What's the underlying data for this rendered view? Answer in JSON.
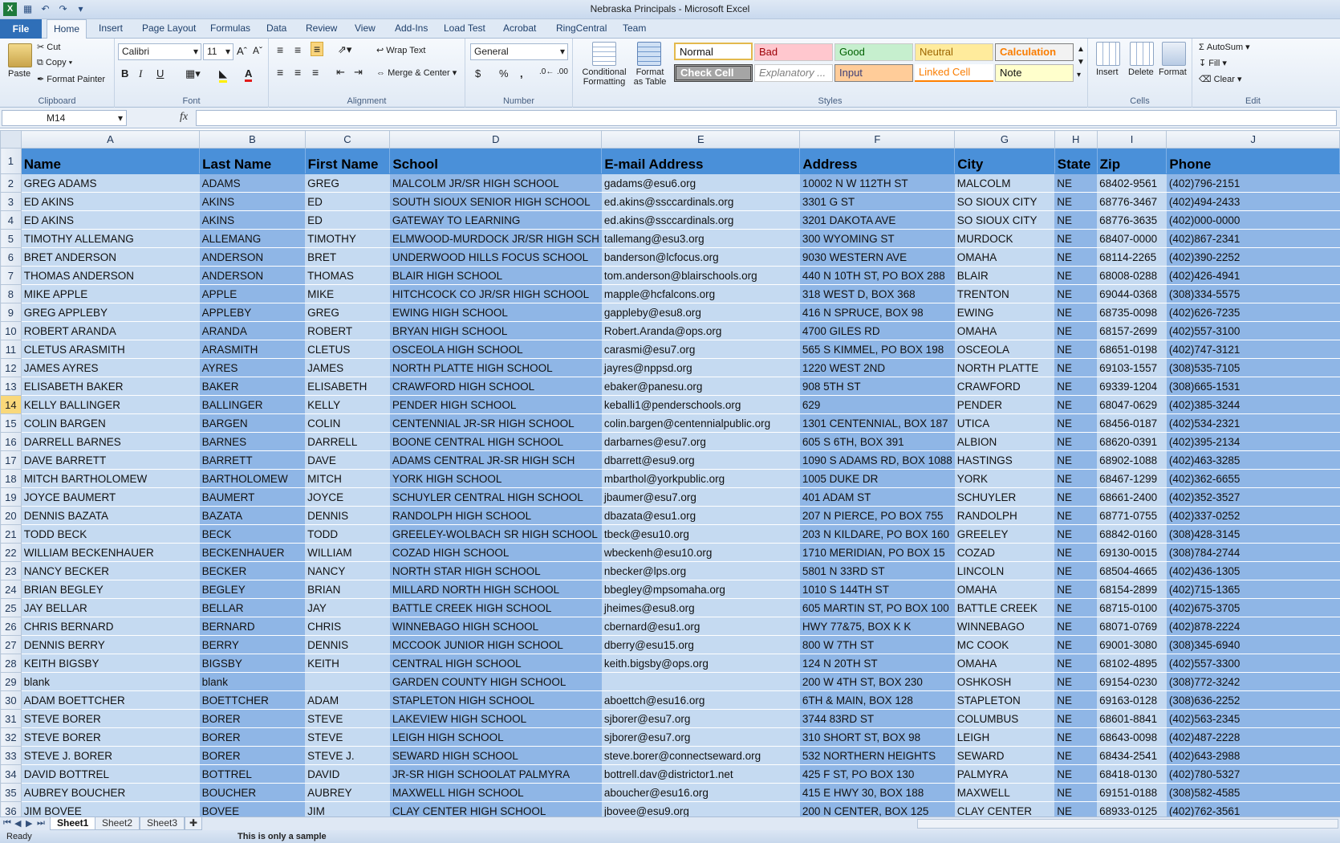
{
  "app": {
    "window_title": "Nebraska Principals  -  Microsoft Excel"
  },
  "menu": {
    "file": "File",
    "tabs": [
      "Home",
      "Insert",
      "Page Layout",
      "Formulas",
      "Data",
      "Review",
      "View",
      "Add-Ins",
      "Load Test",
      "Acrobat",
      "RingCentral",
      "Team"
    ]
  },
  "ribbon": {
    "clipboard": {
      "paste": "Paste",
      "cut": "Cut",
      "copy": "Copy",
      "format_painter": "Format Painter",
      "label": "Clipboard"
    },
    "font": {
      "name": "Calibri",
      "size": "11",
      "bold": "B",
      "italic": "I",
      "underline": "U",
      "label": "Font"
    },
    "alignment": {
      "wrap_text": "Wrap Text",
      "merge_center": "Merge & Center",
      "label": "Alignment"
    },
    "number": {
      "format": "General",
      "currency": "$",
      "percent": "%",
      "comma": ",",
      "label": "Number"
    },
    "styles": {
      "conditional_formatting": "Conditional Formatting",
      "format_as_table": "Format as Table",
      "cells": [
        "Normal",
        "Bad",
        "Good",
        "Neutral",
        "Calculation",
        "Check Cell",
        "Explanatory ...",
        "Input",
        "Linked Cell",
        "Note"
      ],
      "label": "Styles"
    },
    "cells": {
      "insert": "Insert",
      "delete": "Delete",
      "format": "Format",
      "label": "Cells"
    },
    "editing": {
      "autosum": "AutoSum",
      "fill": "Fill",
      "clear": "Clear",
      "label": "Edit"
    }
  },
  "formula_bar": {
    "name_box": "M14",
    "fx": "fx",
    "content": ""
  },
  "sheet": {
    "columns": [
      "A",
      "B",
      "C",
      "D",
      "E",
      "F",
      "G",
      "H",
      "I",
      "J"
    ],
    "headers": [
      "Name",
      "Last Name",
      "First Name",
      "School",
      "E-mail Address",
      "Address",
      "City",
      "State",
      "Zip",
      "Phone"
    ],
    "rows": [
      [
        "GREG ADAMS",
        "ADAMS",
        "GREG",
        "MALCOLM JR/SR HIGH SCHOOL",
        "gadams@esu6.org",
        "10002 N W 112TH ST",
        "MALCOLM",
        "NE",
        "68402-9561",
        "(402)796-2151"
      ],
      [
        "ED AKINS",
        "AKINS",
        "ED",
        "SOUTH SIOUX SENIOR HIGH SCHOOL",
        "ed.akins@ssccardinals.org",
        "3301 G ST",
        "SO SIOUX CITY",
        "NE",
        "68776-3467",
        "(402)494-2433"
      ],
      [
        "ED AKINS",
        "AKINS",
        "ED",
        "GATEWAY TO LEARNING",
        "ed.akins@ssccardinals.org",
        "3201 DAKOTA AVE",
        "SO SIOUX CITY",
        "NE",
        "68776-3635",
        "(402)000-0000"
      ],
      [
        "TIMOTHY ALLEMANG",
        "ALLEMANG",
        "TIMOTHY",
        "ELMWOOD-MURDOCK JR/SR HIGH SCH",
        "tallemang@esu3.org",
        "300 WYOMING ST",
        "MURDOCK",
        "NE",
        "68407-0000",
        "(402)867-2341"
      ],
      [
        "BRET ANDERSON",
        "ANDERSON",
        "BRET",
        "UNDERWOOD HILLS FOCUS SCHOOL",
        "banderson@lcfocus.org",
        "9030 WESTERN AVE",
        "OMAHA",
        "NE",
        "68114-2265",
        "(402)390-2252"
      ],
      [
        "THOMAS ANDERSON",
        "ANDERSON",
        "THOMAS",
        "BLAIR HIGH SCHOOL",
        "tom.anderson@blairschools.org",
        "440 N 10TH ST, PO BOX 288",
        "BLAIR",
        "NE",
        "68008-0288",
        "(402)426-4941"
      ],
      [
        "MIKE APPLE",
        "APPLE",
        "MIKE",
        "HITCHCOCK CO JR/SR HIGH SCHOOL",
        "mapple@hcfalcons.org",
        "318 WEST D, BOX 368",
        "TRENTON",
        "NE",
        "69044-0368",
        "(308)334-5575"
      ],
      [
        "GREG APPLEBY",
        "APPLEBY",
        "GREG",
        "EWING HIGH SCHOOL",
        "gappleby@esu8.org",
        "416 N SPRUCE, BOX 98",
        "EWING",
        "NE",
        "68735-0098",
        "(402)626-7235"
      ],
      [
        "ROBERT ARANDA",
        "ARANDA",
        "ROBERT",
        "BRYAN HIGH SCHOOL",
        "Robert.Aranda@ops.org",
        "4700 GILES RD",
        "OMAHA",
        "NE",
        "68157-2699",
        "(402)557-3100"
      ],
      [
        "CLETUS ARASMITH",
        "ARASMITH",
        "CLETUS",
        "OSCEOLA HIGH SCHOOL",
        "carasmi@esu7.org",
        "565 S KIMMEL, PO BOX 198",
        "OSCEOLA",
        "NE",
        "68651-0198",
        "(402)747-3121"
      ],
      [
        "JAMES AYRES",
        "AYRES",
        "JAMES",
        "NORTH PLATTE HIGH SCHOOL",
        "jayres@nppsd.org",
        "1220 WEST 2ND",
        "NORTH PLATTE",
        "NE",
        "69103-1557",
        "(308)535-7105"
      ],
      [
        "ELISABETH BAKER",
        "BAKER",
        "ELISABETH",
        "CRAWFORD HIGH SCHOOL",
        "ebaker@panesu.org",
        "908 5TH ST",
        "CRAWFORD",
        "NE",
        "69339-1204",
        "(308)665-1531"
      ],
      [
        "KELLY BALLINGER",
        "BALLINGER",
        "KELLY",
        "PENDER HIGH SCHOOL",
        "keballi1@penderschools.org",
        "629",
        "PENDER",
        "NE",
        "68047-0629",
        "(402)385-3244"
      ],
      [
        "COLIN BARGEN",
        "BARGEN",
        "COLIN",
        "CENTENNIAL JR-SR HIGH SCHOOL",
        "colin.bargen@centennialpublic.org",
        "1301 CENTENNIAL, BOX 187",
        "UTICA",
        "NE",
        "68456-0187",
        "(402)534-2321"
      ],
      [
        "DARRELL BARNES",
        "BARNES",
        "DARRELL",
        "BOONE CENTRAL HIGH SCHOOL",
        "darbarnes@esu7.org",
        "605 S 6TH, BOX 391",
        "ALBION",
        "NE",
        "68620-0391",
        "(402)395-2134"
      ],
      [
        "DAVE BARRETT",
        "BARRETT",
        "DAVE",
        "ADAMS CENTRAL JR-SR HIGH SCH",
        "dbarrett@esu9.org",
        "1090 S ADAMS RD, BOX 1088",
        "HASTINGS",
        "NE",
        "68902-1088",
        "(402)463-3285"
      ],
      [
        "MITCH BARTHOLOMEW",
        "BARTHOLOMEW",
        "MITCH",
        "YORK HIGH SCHOOL",
        "mbarthol@yorkpublic.org",
        "1005 DUKE DR",
        "YORK",
        "NE",
        "68467-1299",
        "(402)362-6655"
      ],
      [
        "JOYCE BAUMERT",
        "BAUMERT",
        "JOYCE",
        "SCHUYLER CENTRAL HIGH SCHOOL",
        "jbaumer@esu7.org",
        "401 ADAM ST",
        "SCHUYLER",
        "NE",
        "68661-2400",
        "(402)352-3527"
      ],
      [
        "DENNIS BAZATA",
        "BAZATA",
        "DENNIS",
        "RANDOLPH HIGH SCHOOL",
        "dbazata@esu1.org",
        "207 N PIERCE, PO BOX 755",
        "RANDOLPH",
        "NE",
        "68771-0755",
        "(402)337-0252"
      ],
      [
        "TODD BECK",
        "BECK",
        "TODD",
        "GREELEY-WOLBACH SR HIGH SCHOOL",
        "tbeck@esu10.org",
        "203 N KILDARE, PO BOX 160",
        "GREELEY",
        "NE",
        "68842-0160",
        "(308)428-3145"
      ],
      [
        "WILLIAM BECKENHAUER",
        "BECKENHAUER",
        "WILLIAM",
        "COZAD HIGH SCHOOL",
        "wbeckenh@esu10.org",
        "1710 MERIDIAN, PO BOX 15",
        "COZAD",
        "NE",
        "69130-0015",
        "(308)784-2744"
      ],
      [
        "NANCY BECKER",
        "BECKER",
        "NANCY",
        "NORTH STAR HIGH SCHOOL",
        "nbecker@lps.org",
        "5801 N 33RD ST",
        "LINCOLN",
        "NE",
        "68504-4665",
        "(402)436-1305"
      ],
      [
        "BRIAN BEGLEY",
        "BEGLEY",
        "BRIAN",
        "MILLARD NORTH HIGH SCHOOL",
        "bbegley@mpsomaha.org",
        "1010 S 144TH ST",
        "OMAHA",
        "NE",
        "68154-2899",
        "(402)715-1365"
      ],
      [
        "JAY BELLAR",
        "BELLAR",
        "JAY",
        "BATTLE CREEK HIGH SCHOOL",
        "jheimes@esu8.org",
        "605 MARTIN ST, PO BOX 100",
        "BATTLE CREEK",
        "NE",
        "68715-0100",
        "(402)675-3705"
      ],
      [
        "CHRIS BERNARD",
        "BERNARD",
        "CHRIS",
        "WINNEBAGO HIGH SCHOOL",
        "cbernard@esu1.org",
        "HWY 77&75, BOX K K",
        "WINNEBAGO",
        "NE",
        "68071-0769",
        "(402)878-2224"
      ],
      [
        "DENNIS BERRY",
        "BERRY",
        "DENNIS",
        "MCCOOK JUNIOR HIGH SCHOOL",
        "dberry@esu15.org",
        "800 W 7TH ST",
        "MC COOK",
        "NE",
        "69001-3080",
        "(308)345-6940"
      ],
      [
        "KEITH BIGSBY",
        "BIGSBY",
        "KEITH",
        "CENTRAL HIGH SCHOOL",
        "keith.bigsby@ops.org",
        "124 N 20TH ST",
        "OMAHA",
        "NE",
        "68102-4895",
        "(402)557-3300"
      ],
      [
        " blank",
        "blank",
        "",
        "GARDEN COUNTY HIGH SCHOOL",
        "",
        "200 W 4TH ST, BOX 230",
        "OSHKOSH",
        "NE",
        "69154-0230",
        "(308)772-3242"
      ],
      [
        "ADAM BOETTCHER",
        "BOETTCHER",
        "ADAM",
        "STAPLETON HIGH SCHOOL",
        "aboettch@esu16.org",
        "6TH & MAIN, BOX 128",
        "STAPLETON",
        "NE",
        "69163-0128",
        "(308)636-2252"
      ],
      [
        "STEVE BORER",
        "BORER",
        "STEVE",
        "LAKEVIEW HIGH SCHOOL",
        "sjborer@esu7.org",
        "3744 83RD ST",
        "COLUMBUS",
        "NE",
        "68601-8841",
        "(402)563-2345"
      ],
      [
        "STEVE BORER",
        "BORER",
        "STEVE",
        "LEIGH HIGH SCHOOL",
        "sjborer@esu7.org",
        "310 SHORT ST, BOX 98",
        "LEIGH",
        "NE",
        "68643-0098",
        "(402)487-2228"
      ],
      [
        "STEVE J. BORER",
        "BORER",
        "STEVE J.",
        "SEWARD HIGH SCHOOL",
        "steve.borer@connectseward.org",
        "532 NORTHERN HEIGHTS",
        "SEWARD",
        "NE",
        "68434-2541",
        "(402)643-2988"
      ],
      [
        "DAVID BOTTREL",
        "BOTTREL",
        "DAVID",
        "JR-SR HIGH SCHOOLAT PALMYRA",
        "bottrell.dav@districtor1.net",
        "425 F ST, PO BOX 130",
        "PALMYRA",
        "NE",
        "68418-0130",
        "(402)780-5327"
      ],
      [
        "AUBREY BOUCHER",
        "BOUCHER",
        "AUBREY",
        "MAXWELL HIGH SCHOOL",
        "aboucher@esu16.org",
        "415 E HWY 30, BOX 188",
        "MAXWELL",
        "NE",
        "69151-0188",
        "(308)582-4585"
      ],
      [
        "JIM BOVEE",
        "BOVEE",
        "JIM",
        "CLAY CENTER HIGH SCHOOL",
        "jbovee@esu9.org",
        "200 N CENTER, BOX 125",
        "CLAY CENTER",
        "NE",
        "68933-0125",
        "(402)762-3561"
      ]
    ]
  },
  "sheet_tabs": [
    "Sheet1",
    "Sheet2",
    "Sheet3"
  ],
  "status": {
    "ready": "Ready",
    "note": "This is only a sample"
  }
}
